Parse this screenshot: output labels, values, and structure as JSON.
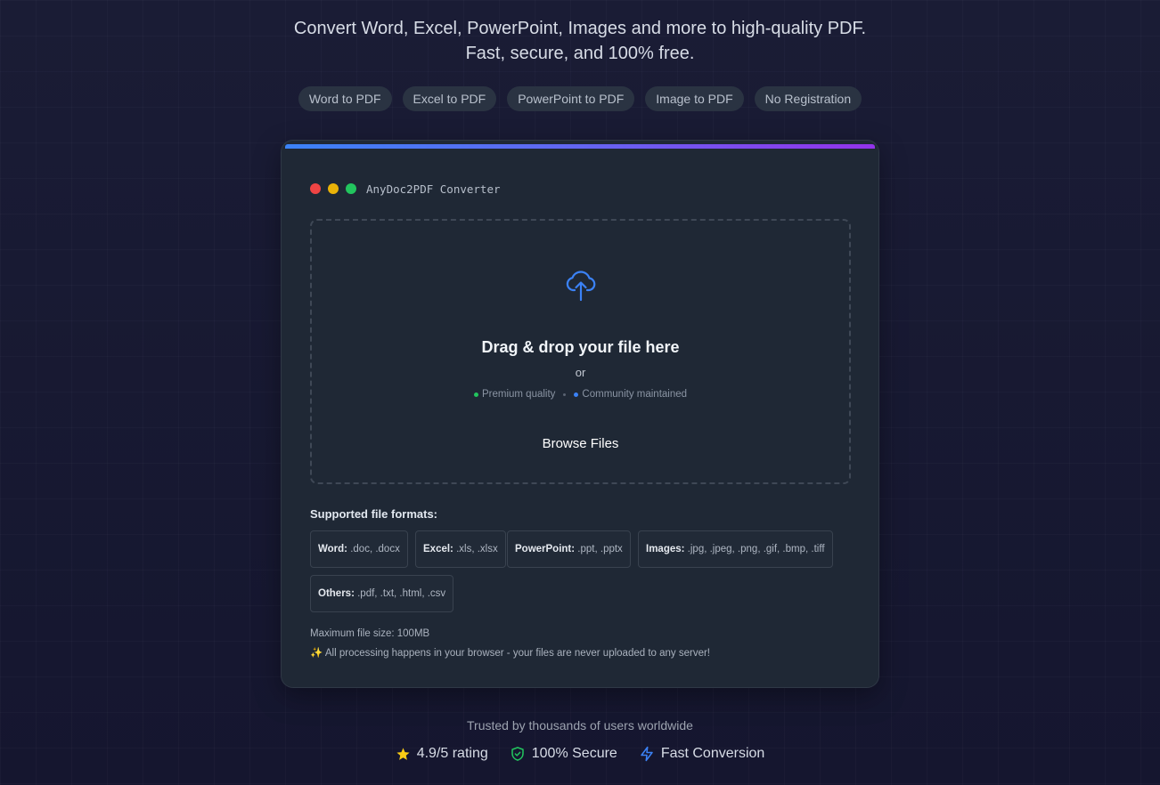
{
  "hero": {
    "subtitle_line1": "Convert Word, Excel, PowerPoint, Images and more to high-quality PDF.",
    "subtitle_line2": "Fast, secure, and 100% free."
  },
  "tags": [
    "Word to PDF",
    "Excel to PDF",
    "PowerPoint to PDF",
    "Image to PDF",
    "No Registration"
  ],
  "card": {
    "window_title": "AnyDoc2PDF Converter",
    "accent_gradient": [
      "#3b82f6",
      "#6366f1",
      "#9333ea"
    ],
    "dropzone": {
      "icon": "cloud-upload-icon",
      "title": "Drag & drop your file here",
      "or": "or",
      "quality_items": [
        "Premium quality",
        "Community maintained"
      ],
      "browse_label": "Browse Files"
    },
    "formats": {
      "label": "Supported file formats:",
      "items": [
        {
          "name": "Word:",
          "ext": ".doc, .docx"
        },
        {
          "name": "Excel:",
          "ext": ".xls, .xlsx"
        },
        {
          "name": "PowerPoint:",
          "ext": ".ppt, .pptx"
        },
        {
          "name": "Images:",
          "ext": ".jpg, .jpeg, .png, .gif, .bmp, .tiff"
        },
        {
          "name": "Others:",
          "ext": ".pdf, .txt, .html, .csv"
        }
      ]
    },
    "max_size": "Maximum file size: 100MB",
    "privacy_note": "✨ All processing happens in your browser - your files are never uploaded to any server!"
  },
  "footer": {
    "trusted": "Trusted by thousands of users worldwide",
    "stats": [
      {
        "icon": "star-icon",
        "label": "4.9/5 rating"
      },
      {
        "icon": "shield-check-icon",
        "label": "100% Secure"
      },
      {
        "icon": "lightning-icon",
        "label": "Fast Conversion"
      }
    ]
  }
}
